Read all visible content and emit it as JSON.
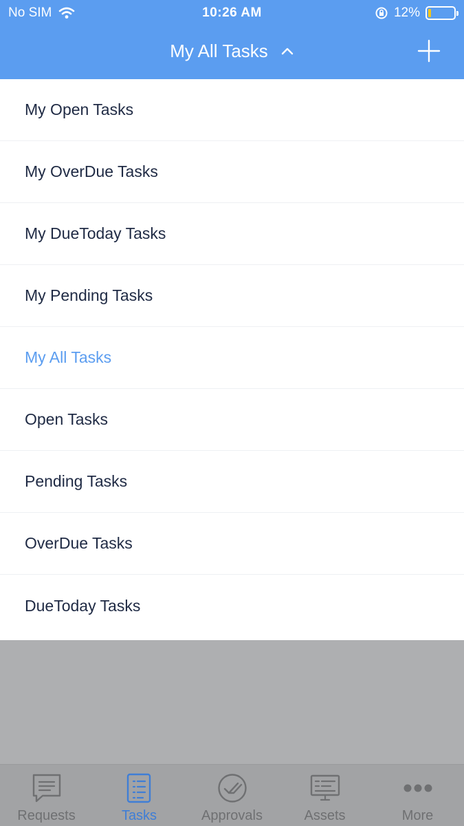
{
  "status_bar": {
    "carrier": "No SIM",
    "time": "10:26 AM",
    "battery_percent_text": "12%",
    "battery_level": 0.12
  },
  "header": {
    "title": "My All Tasks",
    "title_chevron_icon": "chevron-up-icon",
    "add_icon": "plus-icon"
  },
  "filter_menu": {
    "selected_index": 4,
    "items": [
      {
        "label": "My Open Tasks"
      },
      {
        "label": "My OverDue Tasks"
      },
      {
        "label": "My DueToday Tasks"
      },
      {
        "label": "My Pending Tasks"
      },
      {
        "label": "My All Tasks"
      },
      {
        "label": "Open Tasks"
      },
      {
        "label": "Pending Tasks"
      },
      {
        "label": "OverDue Tasks"
      },
      {
        "label": "DueToday Tasks"
      }
    ]
  },
  "tab_bar": {
    "active": "Tasks",
    "tabs": [
      {
        "label": "Requests",
        "icon": "chat-bubble-icon"
      },
      {
        "label": "Tasks",
        "icon": "task-list-icon"
      },
      {
        "label": "Approvals",
        "icon": "approval-check-icon"
      },
      {
        "label": "Assets",
        "icon": "monitor-icon"
      },
      {
        "label": "More",
        "icon": "more-dots-icon"
      }
    ]
  },
  "colors": {
    "header": "#5b9df0",
    "selected_item": "#5b9df0",
    "item_text": "#1f2a44",
    "overlay": "#aeafb1",
    "active_tab": "#3f7ed6",
    "inactive_tab": "#6f7072"
  }
}
